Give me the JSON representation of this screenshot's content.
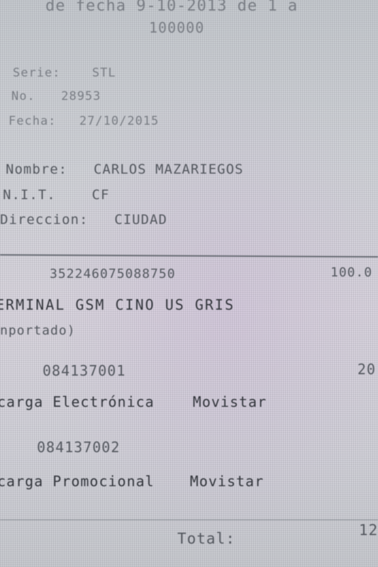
{
  "header": {
    "line1": "de fecha 9-10-2013 de 1 a",
    "line2": "100000"
  },
  "invoice": {
    "serie_label": "Serie:",
    "serie_value": "STL",
    "no_label": "No.",
    "no_value": "28953",
    "fecha_label": "Fecha:",
    "fecha_value": "27/10/2015"
  },
  "customer": {
    "nombre_label": "Nombre:",
    "nombre_value": "CARLOS MAZARIEGOS",
    "nit_label": "N.I.T.",
    "nit_value": "CF",
    "direccion_label": "Direccion:",
    "direccion_value": "CIUDAD"
  },
  "items": [
    {
      "code": "352246075088750",
      "amount": "100.0",
      "description": "ERMINAL GSM CINO US GRIS",
      "note": "nportado)"
    },
    {
      "code": "084137001",
      "amount": "20",
      "description": "carga Electrónica",
      "provider": "Movistar"
    },
    {
      "code": "084137002",
      "description": "carga Promocional",
      "provider": "Movistar"
    }
  ],
  "footer": {
    "total_label": "Total:",
    "total_value": "12"
  }
}
